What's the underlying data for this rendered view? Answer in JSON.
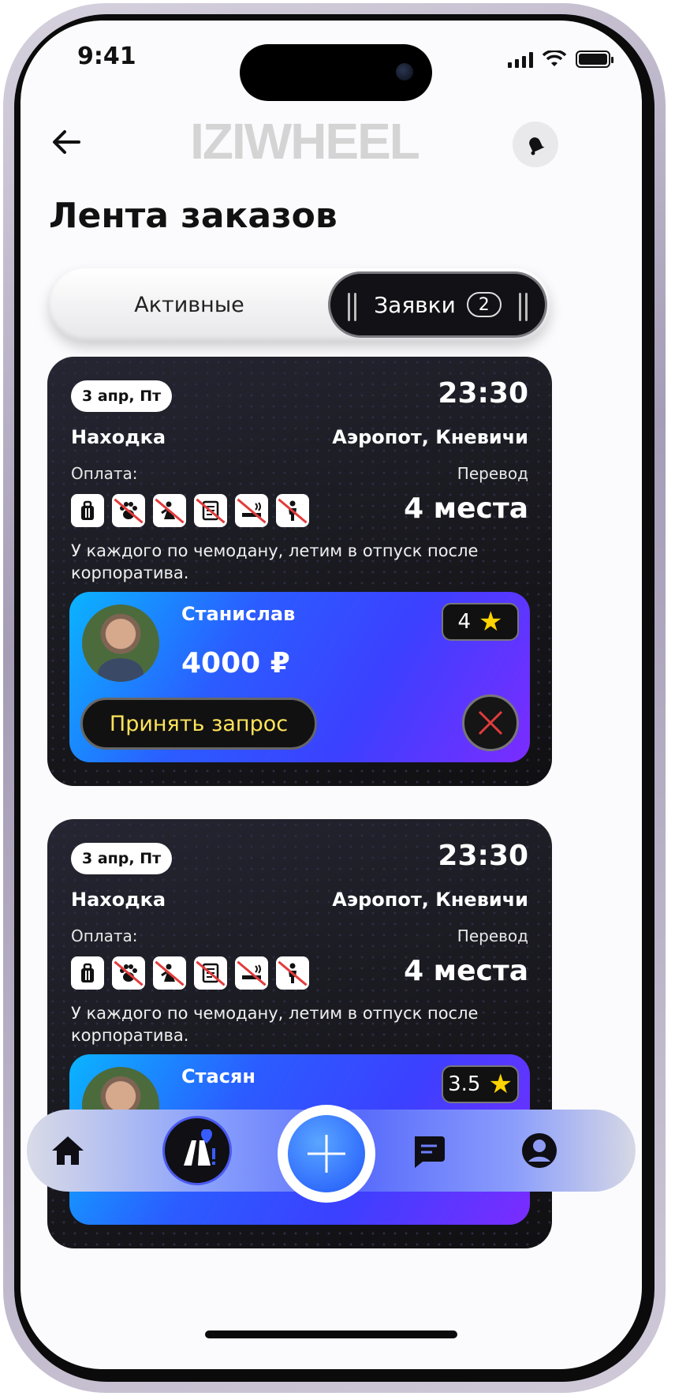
{
  "status_bar": {
    "time": "9:41"
  },
  "header": {
    "logo": "IZIWHEEL",
    "page_title": "Лента заказов"
  },
  "tabs": {
    "active_label": "Активные",
    "requests_label": "Заявки",
    "requests_count": "2"
  },
  "orders": [
    {
      "date": "3 апр, Пт",
      "time": "23:30",
      "from": "Находка",
      "to": "Аэропот, Кневичи",
      "payment_label": "Оплата:",
      "payment_method": "Перевод",
      "amenities": [
        "luggage-icon",
        "no-pets-icon",
        "no-food-icon",
        "no-documents-icon",
        "no-smoking-icon",
        "no-child-icon"
      ],
      "seats": "4 места",
      "comment": "У каждого по чемодану, летим в отпуск после корпоратива.",
      "request": {
        "name": "Станислав",
        "price": "4000 ₽",
        "rating": "4",
        "accept_label": "Принять запрос"
      }
    },
    {
      "date": "3 апр, Пт",
      "time": "23:30",
      "from": "Находка",
      "to": "Аэропот, Кневичи",
      "payment_label": "Оплата:",
      "payment_method": "Перевод",
      "amenities": [
        "luggage-icon",
        "no-pets-icon",
        "no-food-icon",
        "no-documents-icon",
        "no-smoking-icon",
        "no-child-icon"
      ],
      "seats": "4 места",
      "comment": "У каждого по чемодану, летим в отпуск после корпоратива.",
      "request": {
        "name": "Стасян",
        "rating": "3.5"
      }
    }
  ],
  "bottom_nav": [
    "home-icon",
    "route-icon",
    "add-icon",
    "chat-icon",
    "profile-icon"
  ],
  "colors": {
    "accent_yellow": "#ffe45a",
    "offer_gradient_start": "#0ab4ff",
    "offer_gradient_end": "#7b2cff",
    "decline_red": "#e23b3b"
  }
}
